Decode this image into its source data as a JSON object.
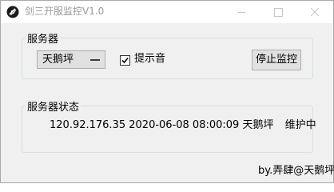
{
  "window": {
    "title": "剑三开服监控V1.0"
  },
  "server_group": {
    "legend": "服务器",
    "server_select_value": "天鹅坪",
    "sound_checkbox_checked": true,
    "sound_checkbox_label": "提示音",
    "stop_button_label": "停止监控"
  },
  "status_group": {
    "legend": "服务器状态",
    "ip": "120.92.176.35",
    "datetime": "2020-06-08 08:00:09",
    "server_name": "天鹅坪",
    "status": "维护中"
  },
  "credit": "by.弄肆@天鹅坪",
  "icons": {
    "app": "app-logo-icon",
    "minimize": "minimize-icon",
    "maximize": "maximize-icon",
    "close": "close-icon",
    "check": "check-icon"
  }
}
